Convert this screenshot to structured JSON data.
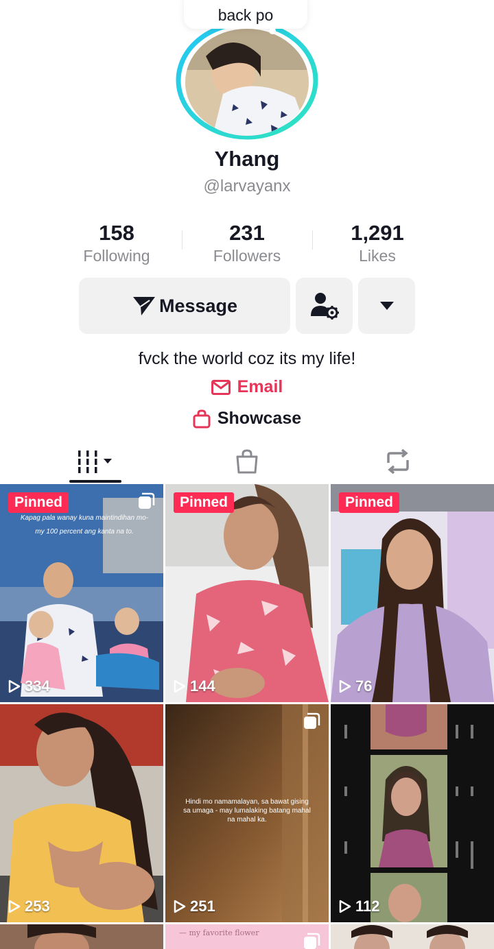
{
  "note": {
    "text": "back po"
  },
  "profile": {
    "display_name": "Yhang",
    "username": "@larvayanx",
    "bio": "fvck the world coz its my life!"
  },
  "stats": [
    {
      "value": "158",
      "label": "Following"
    },
    {
      "value": "231",
      "label": "Followers"
    },
    {
      "value": "1,291",
      "label": "Likes"
    }
  ],
  "actions": {
    "message_label": "Message",
    "add_friend_icon": "person-gear-icon",
    "more_icon": "caret-down-icon"
  },
  "links": {
    "email_label": "Email",
    "showcase_label": "Showcase"
  },
  "tabs": [
    {
      "icon": "grid-icon",
      "active": true
    },
    {
      "icon": "shopping-bag-icon",
      "active": false
    },
    {
      "icon": "repost-icon",
      "active": false
    }
  ],
  "colors": {
    "accent": "#fe2c55",
    "email": "#e5365a",
    "ring_a": "#25c6f4",
    "ring_b": "#2fe3c0",
    "muted": "#8a8b91"
  },
  "videos": [
    {
      "pinned_label": "Pinned",
      "views": "334",
      "multi": true,
      "caption_text": "Kapag pala wanay kuna maintindihan mo-my 100 percent ang kanta na to."
    },
    {
      "pinned_label": "Pinned",
      "views": "144",
      "multi": false
    },
    {
      "pinned_label": "Pinned",
      "views": "76",
      "multi": false
    },
    {
      "pinned_label": "",
      "views": "253",
      "multi": false
    },
    {
      "pinned_label": "",
      "views": "251",
      "multi": true,
      "caption_text": "Hindi mo namamalayan, sa bawat gising sa umaga - may lumalaking batang mahal na mahal ka."
    },
    {
      "pinned_label": "",
      "views": "112",
      "multi": false
    }
  ],
  "partial_row": {
    "caption_text": "— my favorite flower"
  }
}
